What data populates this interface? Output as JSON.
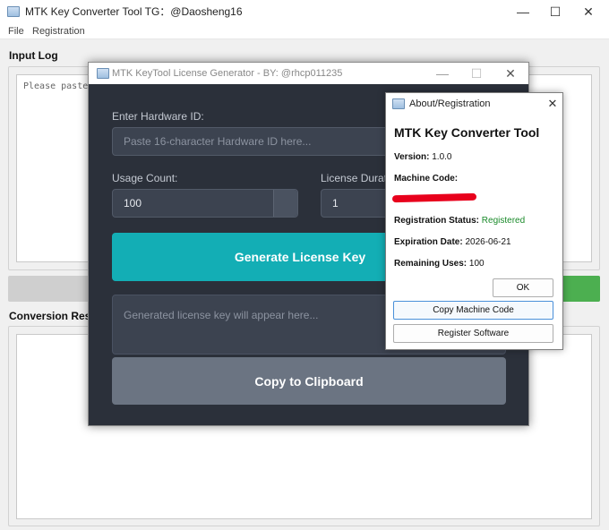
{
  "main_window": {
    "title": "MTK Key Converter Tool   TG：@Daosheng16",
    "menu": [
      "File",
      "Registration"
    ],
    "input_log": {
      "label": "Input Log",
      "placeholder": "Please paste"
    },
    "conversion_results": {
      "label": "Conversion Resu"
    },
    "caption_buttons": [
      "—",
      "☐",
      "✕"
    ]
  },
  "generator": {
    "title": "MTK KeyTool License Generator - BY: @rhcp011235",
    "hardware_id_label": "Enter Hardware ID:",
    "hardware_id_placeholder": "Paste 16-character Hardware ID here...",
    "usage_count_label": "Usage Count:",
    "usage_count_value": "100",
    "license_duration_label": "License Durati",
    "license_duration_value": "1",
    "generate_button": "Generate License Key",
    "output_placeholder": "Generated license key will appear here...",
    "copy_button": "Copy to Clipboard",
    "caption_buttons": [
      "—",
      "☐",
      "✕"
    ]
  },
  "about": {
    "title": "About/Registration",
    "app_name": "MTK Key Converter Tool",
    "version_label": "Version:",
    "version_value": "1.0.0",
    "machine_code_label": "Machine Code:",
    "registration_status_label": "Registration Status:",
    "registration_status_value": "Registered",
    "expiration_label": "Expiration Date:",
    "expiration_value": "2026-06-21",
    "remaining_label": "Remaining Uses:",
    "remaining_value": "100",
    "ok_button": "OK",
    "copy_machine_code_button": "Copy Machine Code",
    "register_button": "Register Software",
    "close_glyph": "✕"
  },
  "colors": {
    "accent_teal": "#13aeb5",
    "registered_green": "#1a8a2a",
    "redaction_red": "#e8001c",
    "progress_green": "#4caf50"
  }
}
